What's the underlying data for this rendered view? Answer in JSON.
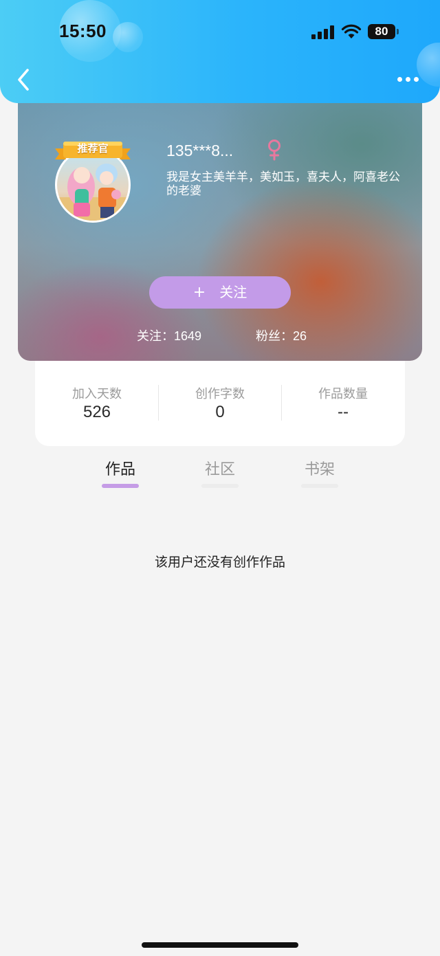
{
  "status_bar": {
    "time": "15:50",
    "battery": "80"
  },
  "nav": {
    "back_icon": "chevron-left-icon",
    "more_icon": "more-horizontal-icon"
  },
  "profile": {
    "badge": "推荐官",
    "username": "135***8...",
    "gender_icon": "female-icon",
    "bio": "我是女主美羊羊，美如玉，喜夫人，阿喜老公的老婆",
    "follow_button": "关注",
    "following_label": "关注：1649",
    "followers_label": "粉丝：26"
  },
  "stats": [
    {
      "label": "加入天数",
      "value": "526"
    },
    {
      "label": "创作字数",
      "value": "0"
    },
    {
      "label": "作品数量",
      "value": "--"
    }
  ],
  "tabs": [
    {
      "label": "作品",
      "active": true
    },
    {
      "label": "社区",
      "active": false
    },
    {
      "label": "书架",
      "active": false
    }
  ],
  "empty_state": "该用户还没有创作作品",
  "colors": {
    "header_start": "#4ccdf5",
    "header_end": "#1ea8fb",
    "accent_purple": "#c39be8",
    "female_pink": "#e8789e"
  }
}
